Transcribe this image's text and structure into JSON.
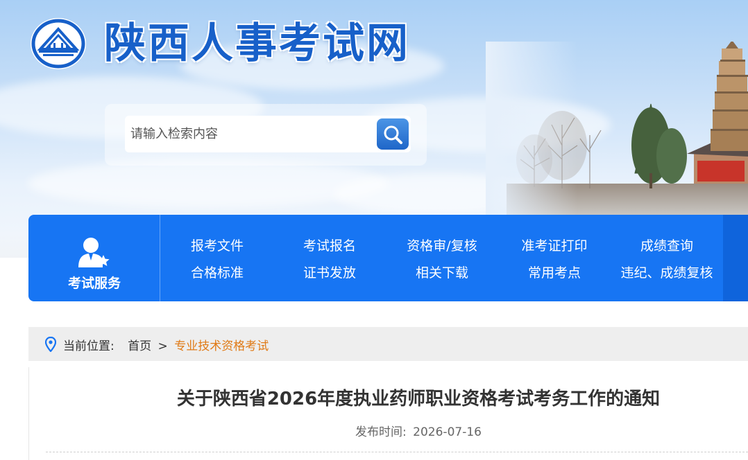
{
  "site": {
    "title": "陕西人事考试网",
    "brand_color": "#1760c9"
  },
  "search": {
    "placeholder": "请输入检索内容",
    "button_icon": "search-icon"
  },
  "nav": {
    "service_label": "考试服务",
    "service_icon": "user-star-icon",
    "color": "#1775f3",
    "links": [
      {
        "label": "报考文件"
      },
      {
        "label": "考试报名"
      },
      {
        "label": "资格审/复核"
      },
      {
        "label": "准考证打印"
      },
      {
        "label": "成绩查询"
      },
      {
        "label": "合格标准"
      },
      {
        "label": "证书发放"
      },
      {
        "label": "相关下载"
      },
      {
        "label": "常用考点"
      },
      {
        "label": "违纪、成绩复核"
      }
    ]
  },
  "breadcrumb": {
    "prefix": "当前位置:",
    "home": "首页",
    "separator": ">",
    "current": "专业技术资格考试",
    "current_color": "#e07a16"
  },
  "article": {
    "title": "关于陕西省2026年度执业药师职业资格考试考务工作的通知",
    "publish_label": "发布时间:",
    "publish_date": "2026-07-16"
  }
}
